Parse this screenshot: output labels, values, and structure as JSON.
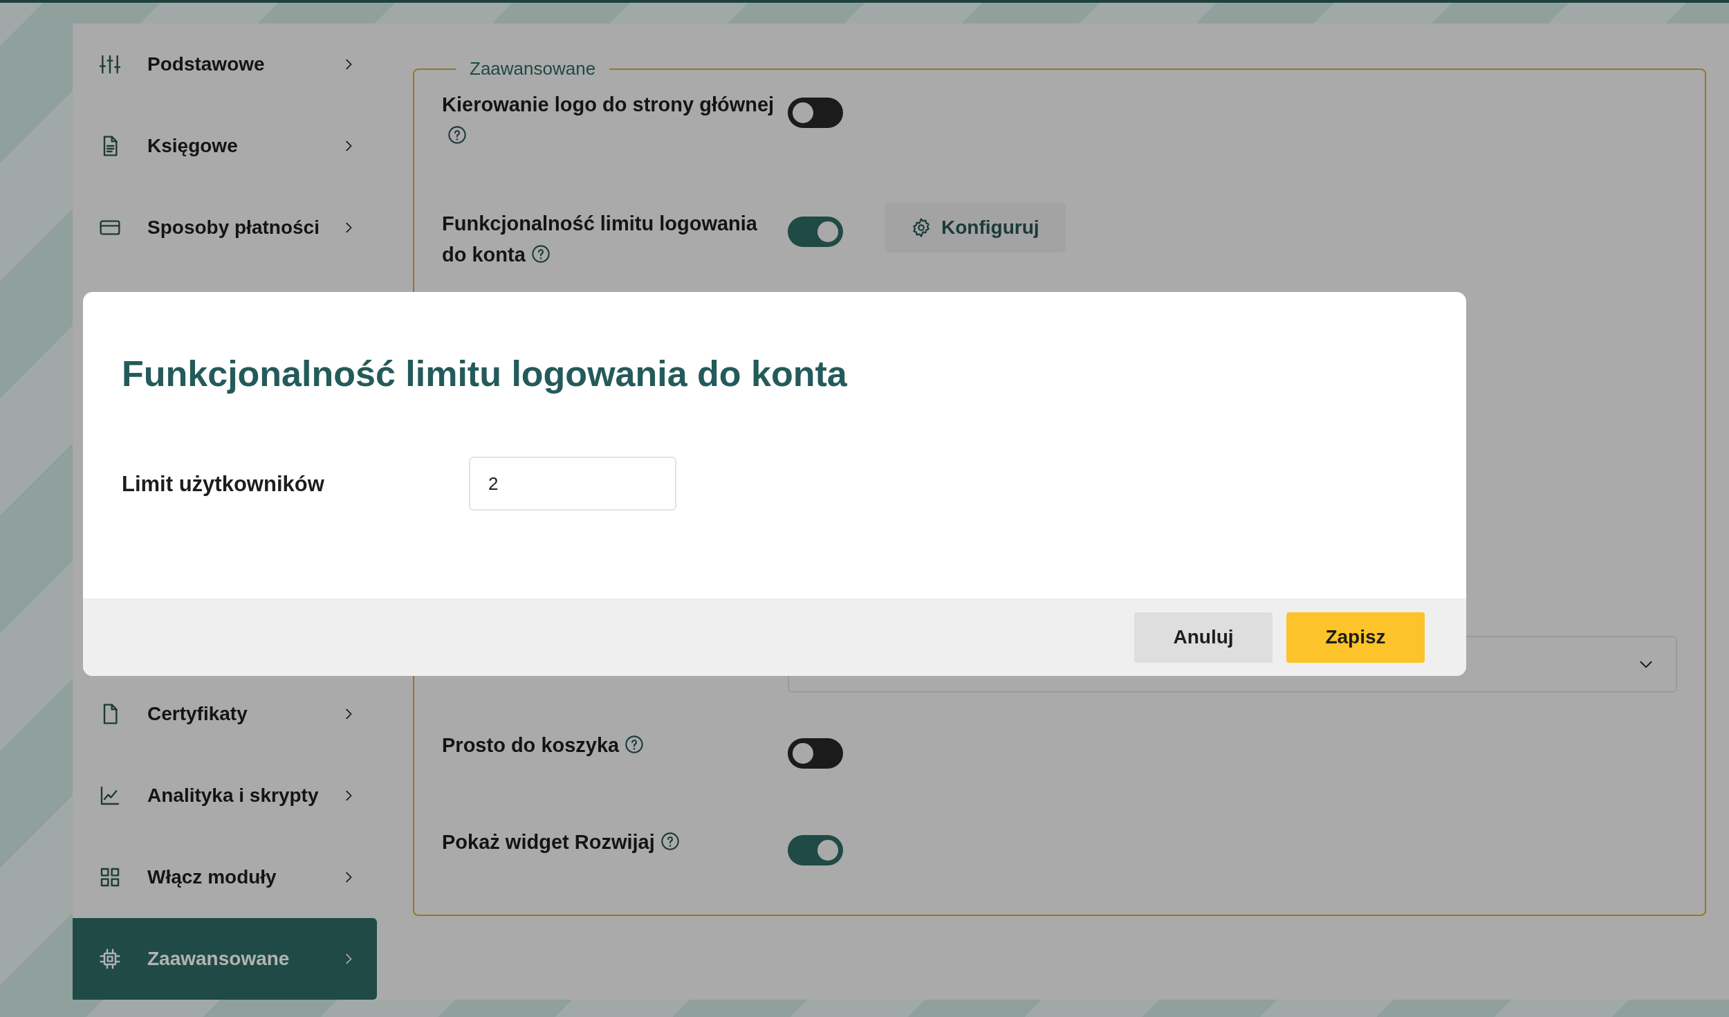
{
  "sidebar": {
    "items_top": [
      {
        "label": "Podstawowe",
        "selected": false
      },
      {
        "label": "Księgowe",
        "selected": false
      },
      {
        "label": "Sposoby płatności",
        "selected": false
      }
    ],
    "items_bottom": [
      {
        "label": "Certyfikaty",
        "selected": false
      },
      {
        "label": "Analityka i skrypty",
        "selected": false
      },
      {
        "label": "Włącz moduły",
        "selected": false
      },
      {
        "label": "Zaawansowane",
        "selected": true
      }
    ]
  },
  "section": {
    "legend": "Zaawansowane",
    "rows": [
      {
        "kind": "toggle",
        "label": "Kierowanie logo do strony głównej",
        "on": false
      },
      {
        "kind": "toggle",
        "label": "Funkcjonalność limitu logowania do konta",
        "on": true,
        "button": "Konfiguruj"
      },
      {
        "kind": "select"
      },
      {
        "kind": "toggle",
        "label": "Prosto do koszyka",
        "on": false
      },
      {
        "kind": "toggle",
        "label": "Pokaż widget Rozwijaj",
        "on": true
      }
    ]
  },
  "modal": {
    "title": "Funkcjonalność limitu logowania do konta",
    "field_label": "Limit użytkowników",
    "field_value": "2",
    "buttons": [
      "Anuluj",
      "Zapisz"
    ]
  }
}
